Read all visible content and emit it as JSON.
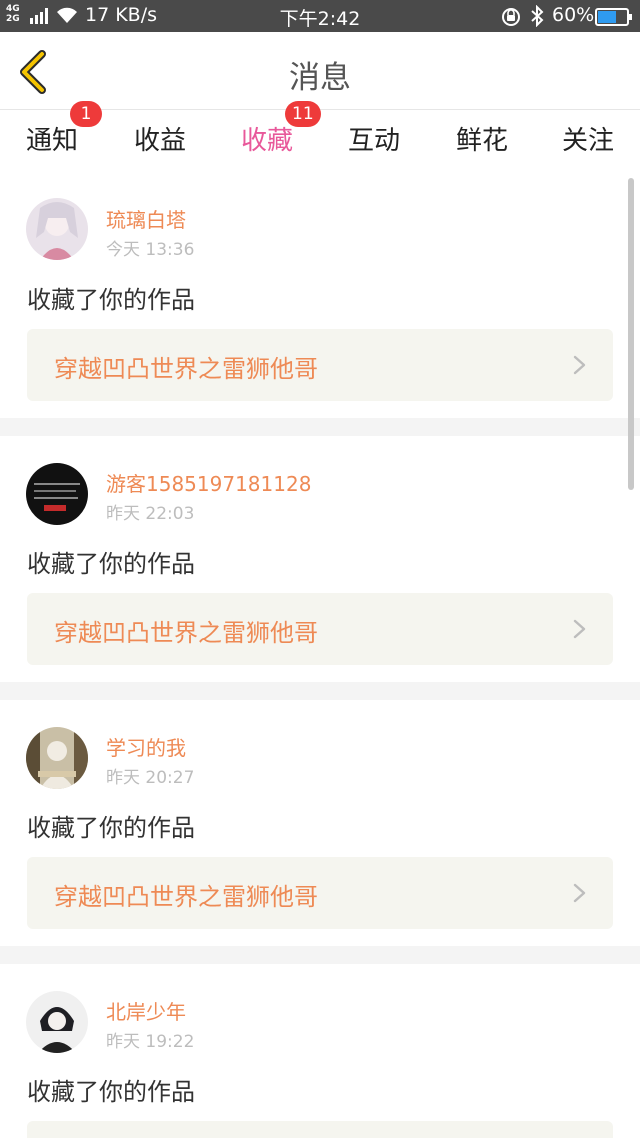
{
  "status_bar": {
    "network_top": "4G",
    "network_bottom": "2G",
    "speed": "17 KB/s",
    "time": "下午2:42",
    "battery": "60%"
  },
  "header": {
    "title": "消息"
  },
  "tabs": [
    {
      "label": "通知",
      "badge": "1"
    },
    {
      "label": "收益"
    },
    {
      "label": "收藏",
      "badge": "11",
      "active": true
    },
    {
      "label": "互动"
    },
    {
      "label": "鲜花"
    },
    {
      "label": "关注"
    }
  ],
  "feed": [
    {
      "username": "琉璃白塔",
      "time": "今天 13:36",
      "action": "收藏了你的作品",
      "work_title": "穿越凹凸世界之雷狮他哥"
    },
    {
      "username": "游客1585197181128",
      "time": "昨天 22:03",
      "action": "收藏了你的作品",
      "work_title": "穿越凹凸世界之雷狮他哥"
    },
    {
      "username": "学习的我",
      "time": "昨天 20:27",
      "action": "收藏了你的作品",
      "work_title": "穿越凹凸世界之雷狮他哥"
    },
    {
      "username": "北岸少年",
      "time": "昨天 19:22",
      "action": "收藏了你的作品"
    }
  ],
  "colors": {
    "accent": "#e8589a",
    "username": "#ee8a55",
    "badge": "#ee3a3a",
    "work_card_bg": "#f5f5ef"
  },
  "icons": [
    "back-chevron-icon",
    "chevron-right-icon",
    "wifi-icon",
    "signal-icon",
    "alarm-icon",
    "bluetooth-icon",
    "battery-icon"
  ]
}
